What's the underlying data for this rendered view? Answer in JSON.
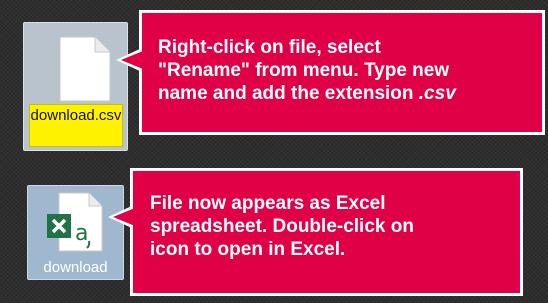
{
  "files": [
    {
      "name_editing": "download.csv",
      "icon": "blank-document-icon",
      "state": "renaming"
    },
    {
      "name": "download",
      "icon": "excel-spreadsheet-icon",
      "state": "selected"
    }
  ],
  "callouts": [
    {
      "lines": [
        "Right-click on file, select",
        "\"Rename\" from menu. Type new",
        "name and add the extension ",
        ".csv"
      ]
    },
    {
      "lines": [
        "File now appears as Excel",
        "spreadsheet. Double-click on",
        "icon to open in Excel."
      ]
    }
  ],
  "colors": {
    "callout_background": "#e00046",
    "callout_border": "#ffffff",
    "rename_highlight": "#fff200",
    "excel_green": "#217346",
    "desktop_background": "#2e2e2e"
  }
}
